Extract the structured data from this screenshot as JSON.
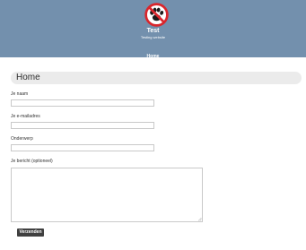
{
  "header": {
    "logo_icon": "paw-prohibited-icon",
    "site_title": "Test",
    "tagline": "Testing website",
    "nav_items": [
      {
        "label": "Home"
      }
    ],
    "background_color": "#7390ad"
  },
  "page": {
    "title": "Home"
  },
  "form": {
    "name_label": "Je naam",
    "name_value": "",
    "email_label": "Je e-mailadres",
    "email_value": "",
    "subject_label": "Onderwerp",
    "subject_value": "",
    "message_label": "Je bericht (optioneel)",
    "message_value": "",
    "submit_label": "Verzenden"
  }
}
